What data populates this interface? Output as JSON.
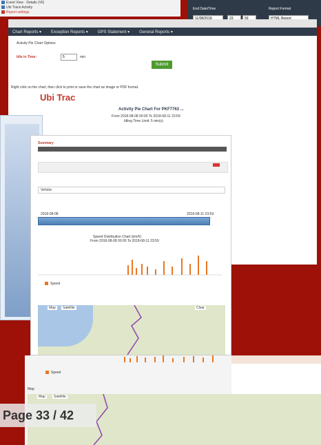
{
  "topbar": {
    "rows": [
      "Event View · Details (V6)",
      "Ubi Track Activity",
      "Report settings"
    ]
  },
  "top_right": {
    "label_end": "End Date/Time",
    "label_report": "Report Format",
    "end_value": "11/08/2018",
    "hour": "23",
    "min": "59",
    "format_value": "HTML Report"
  },
  "nav": {
    "items": [
      "Chart Reports ▾",
      "Exception Reports ▾",
      "GPS Statement ▾",
      "General Reports ▾"
    ]
  },
  "form": {
    "section_title": "Activity Pie Chart Options",
    "idle_label": "Idle in Time:",
    "idle_value": "5",
    "idle_unit": "min",
    "submit_label": "Submit"
  },
  "report": {
    "hint": "Right click on the chart, then click to print or save the chart as image or PDF format.",
    "logo": "Ubi Trac",
    "chart_title": "Activity Pie Chart For PKF7762 ...",
    "range": "From 2018-08-08 00:00 To 2018-08-11 23:59",
    "idle": "Idling Time Limit: 5 min(s)"
  },
  "shot2": {
    "header": "Summary",
    "row_label": "Vehicle",
    "slider_left": "2018-08-08",
    "slider_right": "2018-08-11 23:59",
    "chart_title": "Speed Distribution Chart (km/h)",
    "chart_sub": "From 2018-08-08 00:00 To 2018-08-11 23:59",
    "legend": "Speed",
    "map_btn1": "Map",
    "map_btn2": "Satellite",
    "map_btn3": "Clear"
  },
  "shot3": {
    "legend": "Speed",
    "label": "Map",
    "btn1": "Map",
    "btn2": "Satellite"
  },
  "page": {
    "number": "Page 33 / 42"
  }
}
